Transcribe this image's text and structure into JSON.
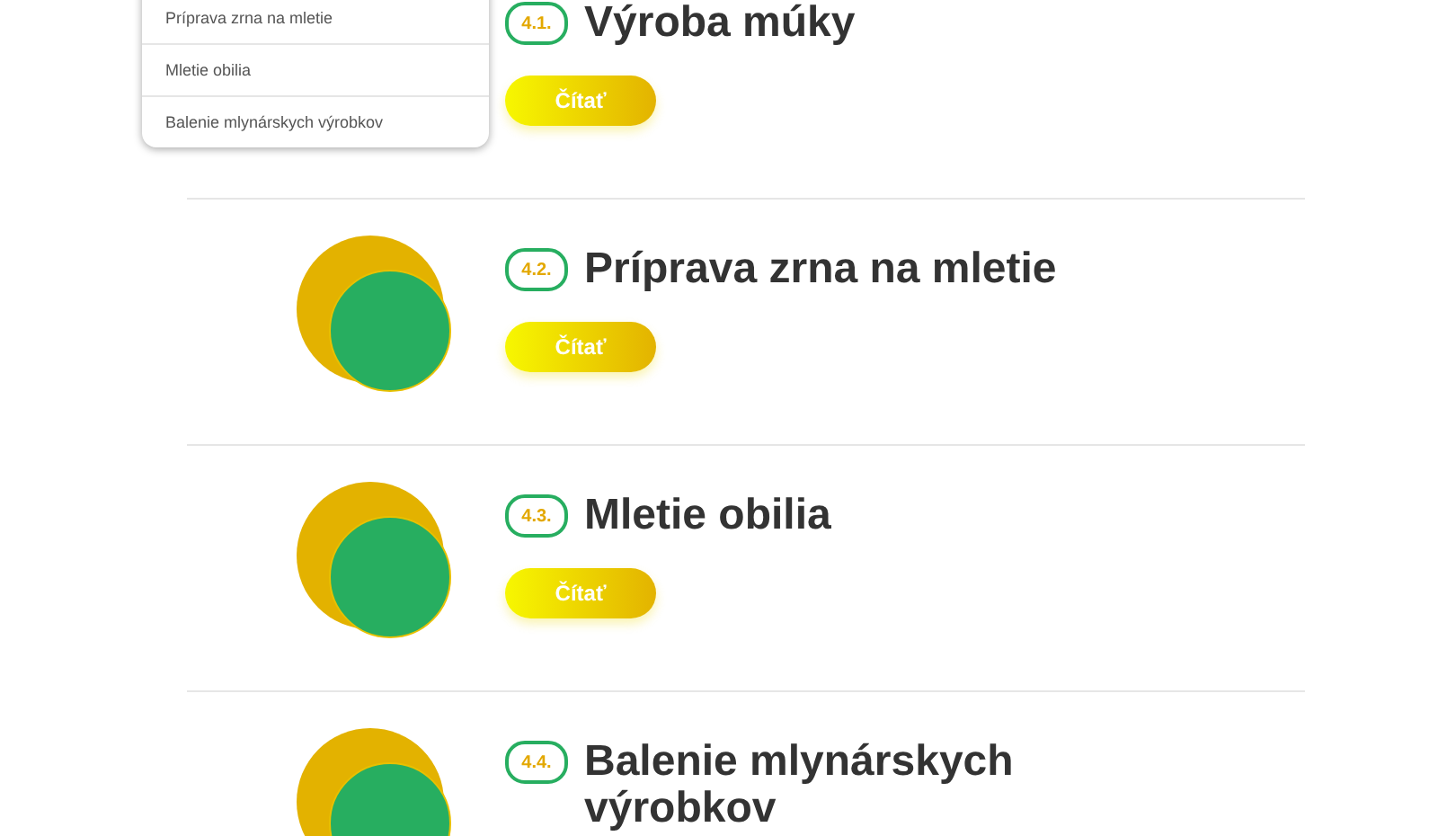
{
  "menu": {
    "items": [
      {
        "label": "Príprava zrna na mletie"
      },
      {
        "label": "Mletie obilia"
      },
      {
        "label": "Balenie mlynárskych výrobkov"
      }
    ]
  },
  "chapters": [
    {
      "number": "4.1.",
      "title": "Výroba múky",
      "button": "Čítať"
    },
    {
      "number": "4.2.",
      "title": "Príprava zrna na mletie",
      "button": "Čítať",
      "circles": true
    },
    {
      "number": "4.3.",
      "title": "Mletie obilia",
      "button": "Čítať",
      "circles": true
    },
    {
      "number": "4.4.",
      "title": "Balenie mlynárskych výrobkov",
      "circles": true
    }
  ]
}
